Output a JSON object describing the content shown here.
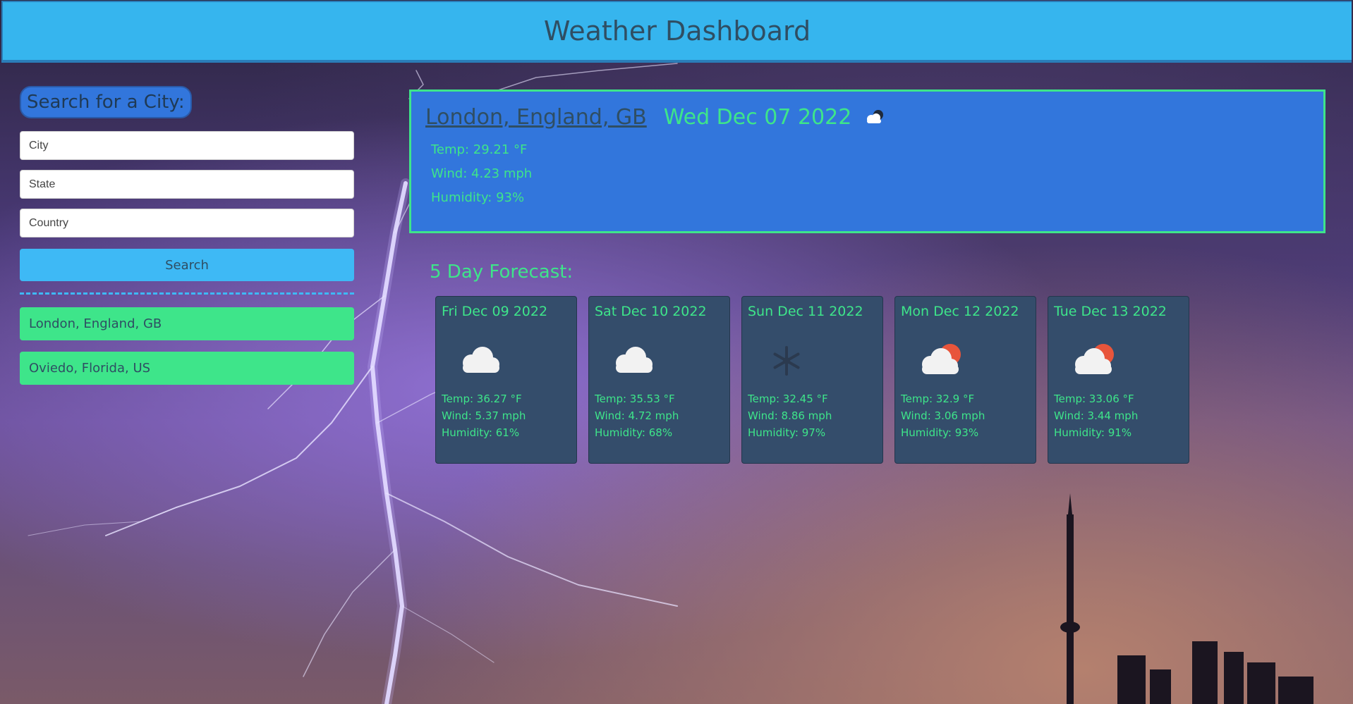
{
  "header": {
    "title": "Weather Dashboard"
  },
  "sidebar": {
    "heading": "Search for a City:",
    "inputs": {
      "city_placeholder": "City",
      "state_placeholder": "State",
      "country_placeholder": "Country"
    },
    "search_label": "Search",
    "history": [
      {
        "label": "London, England, GB"
      },
      {
        "label": "Oviedo, Florida, US"
      }
    ]
  },
  "current": {
    "city": "London, England, GB",
    "date": "Wed Dec 07 2022",
    "icon": "cloud-night-icon",
    "temp": "Temp: 29.21 °F",
    "wind": "Wind: 4.23 mph",
    "humidity": "Humidity: 93%"
  },
  "forecast": {
    "title": "5 Day Forecast:",
    "days": [
      {
        "date": "Fri Dec 09 2022",
        "icon": "cloud-icon",
        "temp": "Temp: 36.27 °F",
        "wind": "Wind: 5.37 mph",
        "humidity": "Humidity: 61%"
      },
      {
        "date": "Sat Dec 10 2022",
        "icon": "cloud-icon",
        "temp": "Temp: 35.53 °F",
        "wind": "Wind: 4.72 mph",
        "humidity": "Humidity: 68%"
      },
      {
        "date": "Sun Dec 11 2022",
        "icon": "snowflake-icon",
        "temp": "Temp: 32.45 °F",
        "wind": "Wind: 8.86 mph",
        "humidity": "Humidity: 97%"
      },
      {
        "date": "Mon Dec 12 2022",
        "icon": "cloud-sun-icon",
        "temp": "Temp: 32.9 °F",
        "wind": "Wind: 3.06 mph",
        "humidity": "Humidity: 93%"
      },
      {
        "date": "Tue Dec 13 2022",
        "icon": "cloud-sun-icon",
        "temp": "Temp: 33.06 °F",
        "wind": "Wind: 3.44 mph",
        "humidity": "Humidity: 91%"
      }
    ]
  },
  "colors": {
    "header_bg": "#36b5ee",
    "accent_green": "#3ee58a",
    "panel_blue": "#3276dc",
    "card_bg": "#344d6b"
  }
}
